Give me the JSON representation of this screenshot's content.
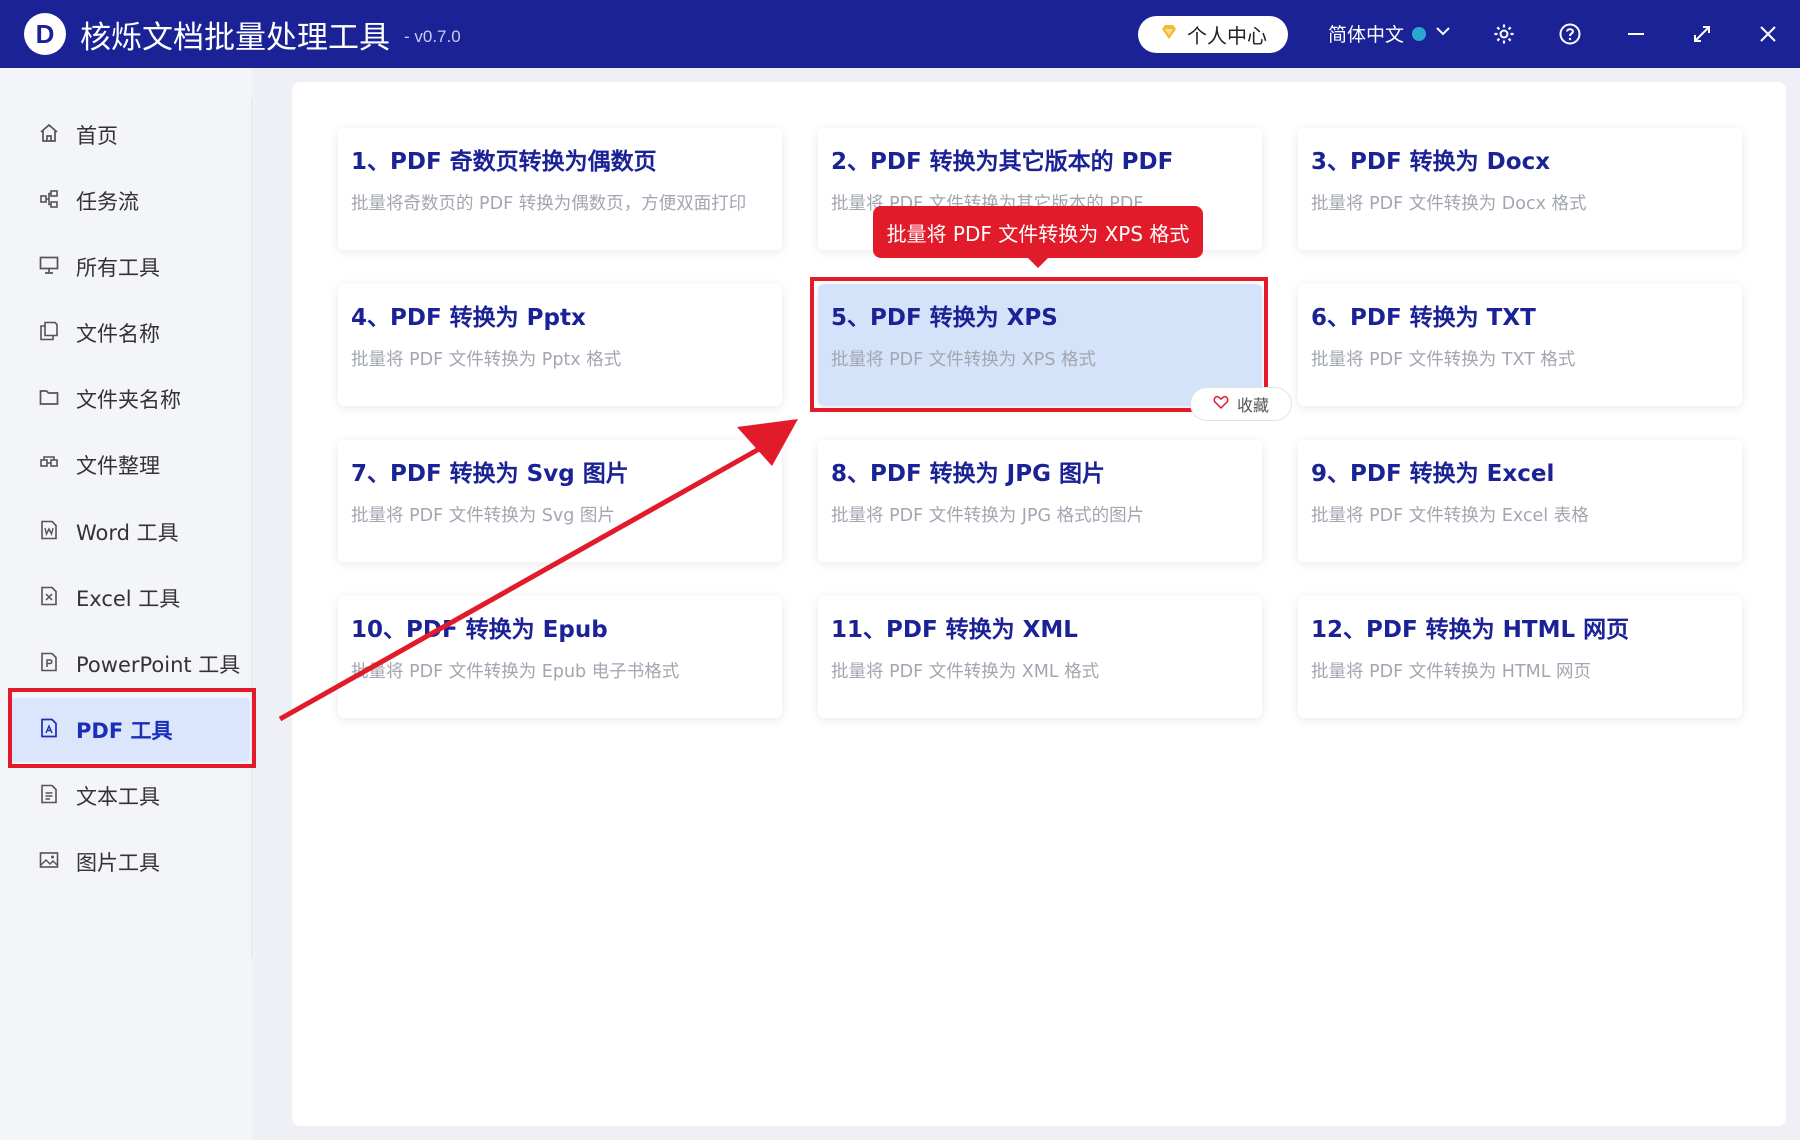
{
  "app": {
    "logo_letter": "D",
    "title": "核烁文档批量处理工具",
    "version": "- v0.7.0"
  },
  "titlebar": {
    "user_center_label": "个人中心",
    "language_label": "简体中文",
    "icons": [
      "diamond-icon",
      "chevron-down-icon",
      "gear-icon",
      "help-icon",
      "minimize-icon",
      "maximize-icon",
      "close-icon"
    ]
  },
  "sidebar": {
    "items": [
      {
        "label": "首页",
        "icon": "home-icon"
      },
      {
        "label": "任务流",
        "icon": "workflow-icon"
      },
      {
        "label": "所有工具",
        "icon": "monitor-icon"
      },
      {
        "label": "文件名称",
        "icon": "file-copy-icon"
      },
      {
        "label": "文件夹名称",
        "icon": "folder-icon"
      },
      {
        "label": "文件整理",
        "icon": "organize-icon"
      },
      {
        "label": "Word 工具",
        "icon": "word-file-icon"
      },
      {
        "label": "Excel 工具",
        "icon": "excel-file-icon"
      },
      {
        "label": "PowerPoint 工具",
        "icon": "ppt-file-icon"
      },
      {
        "label": "PDF 工具",
        "icon": "pdf-file-icon",
        "active": true
      },
      {
        "label": "文本工具",
        "icon": "text-file-icon"
      },
      {
        "label": "图片工具",
        "icon": "image-icon"
      }
    ]
  },
  "tools": [
    {
      "title": "1、PDF 奇数页转换为偶数页",
      "desc": "批量将奇数页的 PDF 转换为偶数页，方便双面打印"
    },
    {
      "title": "2、PDF 转换为其它版本的 PDF",
      "desc": "批量将 PDF 文件转换为其它版本的 PDF"
    },
    {
      "title": "3、PDF 转换为 Docx",
      "desc": "批量将 PDF 文件转换为 Docx 格式"
    },
    {
      "title": "4、PDF 转换为 Pptx",
      "desc": "批量将 PDF 文件转换为 Pptx 格式"
    },
    {
      "title": "5、PDF 转换为 XPS",
      "desc": "批量将 PDF 文件转换为 XPS 格式",
      "highlighted": true
    },
    {
      "title": "6、PDF 转换为 TXT",
      "desc": "批量将 PDF 文件转换为 TXT 格式"
    },
    {
      "title": "7、PDF 转换为 Svg 图片",
      "desc": "批量将 PDF 文件转换为 Svg 图片"
    },
    {
      "title": "8、PDF 转换为 JPG 图片",
      "desc": "批量将 PDF 文件转换为 JPG 格式的图片"
    },
    {
      "title": "9、PDF 转换为 Excel",
      "desc": "批量将 PDF 文件转换为 Excel 表格"
    },
    {
      "title": "10、PDF 转换为 Epub",
      "desc": "批量将 PDF 文件转换为 Epub 电子书格式"
    },
    {
      "title": "11、PDF 转换为 XML",
      "desc": "批量将 PDF 文件转换为 XML 格式"
    },
    {
      "title": "12、PDF 转换为 HTML 网页",
      "desc": "批量将 PDF 文件转换为 HTML 网页"
    }
  ],
  "tooltip": "批量将 PDF 文件转换为 XPS 格式",
  "favorite_label": "收藏",
  "colors": {
    "titlebar": "#1a2296",
    "accent": "#1a2296",
    "annotation_red": "#e11b2a",
    "highlight_card": "#d5e3fa"
  }
}
